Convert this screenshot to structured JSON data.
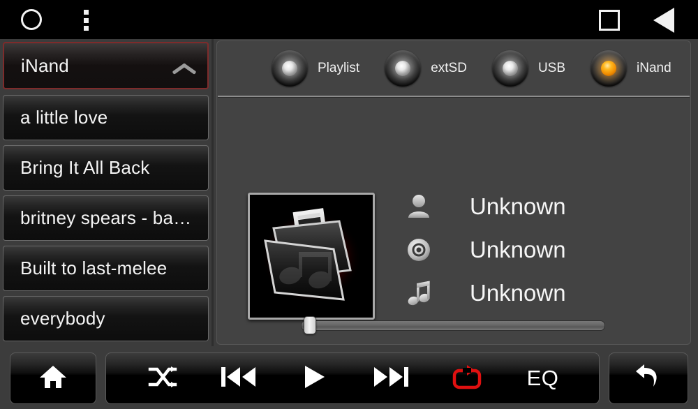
{
  "statusbar": {
    "home_icon": "circle-icon",
    "menu_icon": "overflow-menu-icon",
    "recents_icon": "square-recents-icon",
    "back_icon": "triangle-back-icon"
  },
  "sidebar": {
    "header": {
      "label": "iNand",
      "icon": "chevron-up-icon",
      "border_color": "#7e2b2b"
    },
    "items": [
      {
        "label": "a little love"
      },
      {
        "label": "Bring It All Back"
      },
      {
        "label": "britney spears - ba…"
      },
      {
        "label": "Built to last-melee"
      },
      {
        "label": "everybody"
      }
    ]
  },
  "sources": {
    "options": [
      {
        "label": "Playlist",
        "selected": false
      },
      {
        "label": "extSD",
        "selected": false
      },
      {
        "label": "USB",
        "selected": false
      },
      {
        "label": "iNand",
        "selected": true
      }
    ],
    "active_color": "#ffb81f",
    "inactive_color": "#e8e8e8"
  },
  "now_playing": {
    "album_art": "music-folder-icon",
    "artist": {
      "icon": "person-icon",
      "value": "Unknown"
    },
    "album": {
      "icon": "disc-icon",
      "value": "Unknown"
    },
    "title": {
      "icon": "music-note-icon",
      "value": "Unknown"
    },
    "progress_percent": 0
  },
  "controls": {
    "home": {
      "label": "",
      "icon": "home-icon"
    },
    "shuffle": {
      "label": "",
      "icon": "shuffle-icon",
      "active": false
    },
    "previous": {
      "label": "",
      "icon": "previous-track-icon"
    },
    "play": {
      "label": "",
      "icon": "play-icon"
    },
    "next": {
      "label": "",
      "icon": "next-track-icon"
    },
    "repeat": {
      "label": "",
      "icon": "repeat-icon",
      "active": true,
      "active_color": "#e01010"
    },
    "eq": {
      "label": "EQ",
      "icon": "equalizer-label"
    },
    "back": {
      "label": "",
      "icon": "back-arrow-icon"
    }
  }
}
